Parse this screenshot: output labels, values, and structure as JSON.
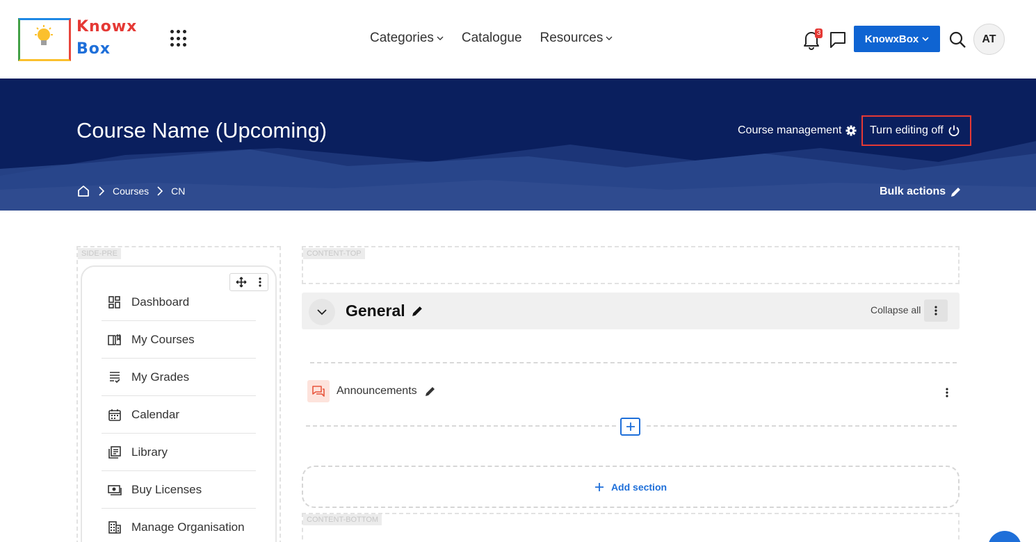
{
  "brand": {
    "logo_line1": "Knowx",
    "logo_line2": "Box"
  },
  "topnav": {
    "links": [
      {
        "label": "Categories",
        "has_dropdown": true
      },
      {
        "label": "Catalogue",
        "has_dropdown": false
      },
      {
        "label": "Resources",
        "has_dropdown": true
      }
    ],
    "notification_count": "3",
    "user_menu_label": "KnowxBox",
    "avatar_initials": "AT"
  },
  "banner": {
    "course_title": "Course Name (Upcoming)",
    "course_management_label": "Course management",
    "edit_toggle_label": "Turn editing off",
    "breadcrumb": [
      "Courses",
      "CN"
    ],
    "bulk_actions_label": "Bulk actions"
  },
  "regions": {
    "side_pre_label": "SIDE-PRE",
    "content_top_label": "CONTENT-TOP",
    "content_bottom_label": "CONTENT-BOTTOM"
  },
  "sidebar": {
    "items": [
      {
        "label": "Dashboard",
        "icon": "dashboard-icon"
      },
      {
        "label": "My Courses",
        "icon": "book-icon"
      },
      {
        "label": "My Grades",
        "icon": "grades-icon"
      },
      {
        "label": "Calendar",
        "icon": "calendar-icon"
      },
      {
        "label": "Library",
        "icon": "library-icon"
      },
      {
        "label": "Buy Licenses",
        "icon": "license-icon"
      },
      {
        "label": "Manage Organisation",
        "icon": "organisation-icon"
      }
    ]
  },
  "course": {
    "section_title": "General",
    "collapse_all_label": "Collapse all",
    "activities": [
      {
        "label": "Announcements",
        "icon": "forum-icon"
      }
    ],
    "add_section_label": "Add section"
  },
  "colors": {
    "primary": "#0f64d2",
    "banner": "#0a1f5e",
    "highlight": "#e53935",
    "activity_icon_bg": "#fde3dc"
  }
}
